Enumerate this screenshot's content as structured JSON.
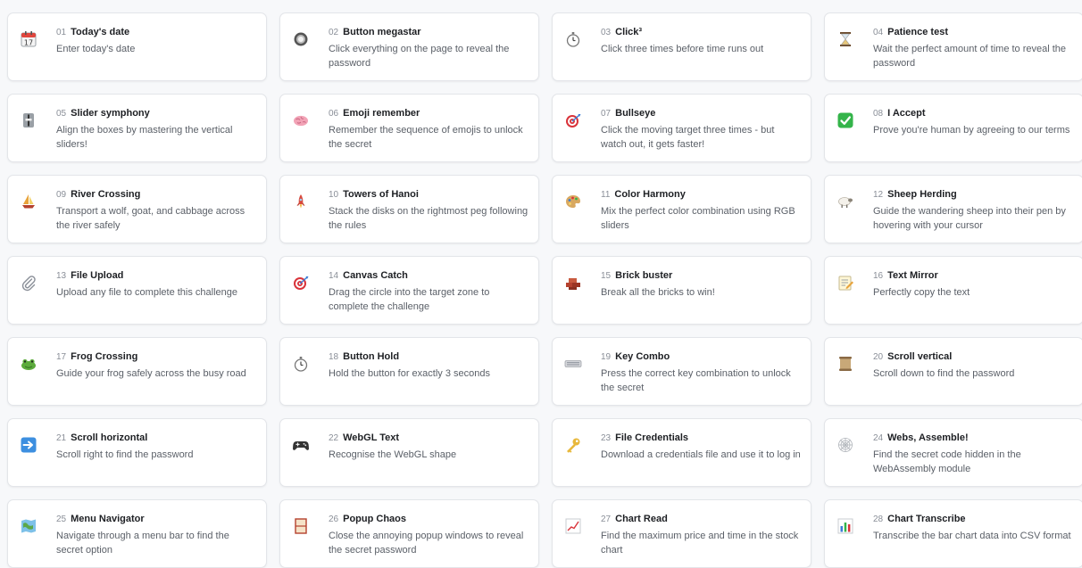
{
  "challenges": [
    {
      "num": "01",
      "title": "Today's date",
      "desc": "Enter today's date",
      "icon": "calendar-icon"
    },
    {
      "num": "02",
      "title": "Button megastar",
      "desc": "Click everything on the page to reveal the password",
      "icon": "ring-button-icon"
    },
    {
      "num": "03",
      "title": "Click³",
      "desc": "Click three times before time runs out",
      "icon": "stopwatch-icon"
    },
    {
      "num": "04",
      "title": "Patience test",
      "desc": "Wait the perfect amount of time to reveal the password",
      "icon": "hourglass-icon"
    },
    {
      "num": "05",
      "title": "Slider symphony",
      "desc": "Align the boxes by mastering the vertical sliders!",
      "icon": "slider-icon"
    },
    {
      "num": "06",
      "title": "Emoji remember",
      "desc": "Remember the sequence of emojis to unlock the secret",
      "icon": "brain-icon"
    },
    {
      "num": "07",
      "title": "Bullseye",
      "desc": "Click the moving target three times - but watch out, it gets faster!",
      "icon": "target-icon"
    },
    {
      "num": "08",
      "title": "I Accept",
      "desc": "Prove you're human by agreeing to our terms",
      "icon": "checkmark-icon"
    },
    {
      "num": "09",
      "title": "River Crossing",
      "desc": "Transport a wolf, goat, and cabbage across the river safely",
      "icon": "sailboat-icon"
    },
    {
      "num": "10",
      "title": "Towers of Hanoi",
      "desc": "Stack the disks on the rightmost peg following the rules",
      "icon": "rocket-icon"
    },
    {
      "num": "11",
      "title": "Color Harmony",
      "desc": "Mix the perfect color combination using RGB sliders",
      "icon": "palette-icon"
    },
    {
      "num": "12",
      "title": "Sheep Herding",
      "desc": "Guide the wandering sheep into their pen by hovering with your cursor",
      "icon": "sheep-icon"
    },
    {
      "num": "13",
      "title": "File Upload",
      "desc": "Upload any file to complete this challenge",
      "icon": "paperclip-icon"
    },
    {
      "num": "14",
      "title": "Canvas Catch",
      "desc": "Drag the circle into the target zone to complete the challenge",
      "icon": "target-icon"
    },
    {
      "num": "15",
      "title": "Brick buster",
      "desc": "Break all the bricks to win!",
      "icon": "bricks-icon"
    },
    {
      "num": "16",
      "title": "Text Mirror",
      "desc": "Perfectly copy the text",
      "icon": "memo-icon"
    },
    {
      "num": "17",
      "title": "Frog Crossing",
      "desc": "Guide your frog safely across the busy road",
      "icon": "frog-icon"
    },
    {
      "num": "18",
      "title": "Button Hold",
      "desc": "Hold the button for exactly 3 seconds",
      "icon": "stopwatch-icon"
    },
    {
      "num": "19",
      "title": "Key Combo",
      "desc": "Press the correct key combination to unlock the secret",
      "icon": "keyboard-icon"
    },
    {
      "num": "20",
      "title": "Scroll vertical",
      "desc": "Scroll down to find the password",
      "icon": "scroll-icon"
    },
    {
      "num": "21",
      "title": "Scroll horizontal",
      "desc": "Scroll right to find the password",
      "icon": "right-arrow-icon"
    },
    {
      "num": "22",
      "title": "WebGL Text",
      "desc": "Recognise the WebGL shape",
      "icon": "gamepad-icon"
    },
    {
      "num": "23",
      "title": "File Credentials",
      "desc": "Download a credentials file and use it to log in",
      "icon": "key-icon"
    },
    {
      "num": "24",
      "title": "Webs, Assemble!",
      "desc": "Find the secret code hidden in the WebAssembly module",
      "icon": "spider-web-icon"
    },
    {
      "num": "25",
      "title": "Menu Navigator",
      "desc": "Navigate through a menu bar to find the secret option",
      "icon": "map-icon"
    },
    {
      "num": "26",
      "title": "Popup Chaos",
      "desc": "Close the annoying popup windows to reveal the secret password",
      "icon": "window-icon"
    },
    {
      "num": "27",
      "title": "Chart Read",
      "desc": "Find the maximum price and time in the stock chart",
      "icon": "line-chart-icon"
    },
    {
      "num": "28",
      "title": "Chart Transcribe",
      "desc": "Transcribe the bar chart data into CSV format",
      "icon": "bar-chart-icon"
    }
  ]
}
